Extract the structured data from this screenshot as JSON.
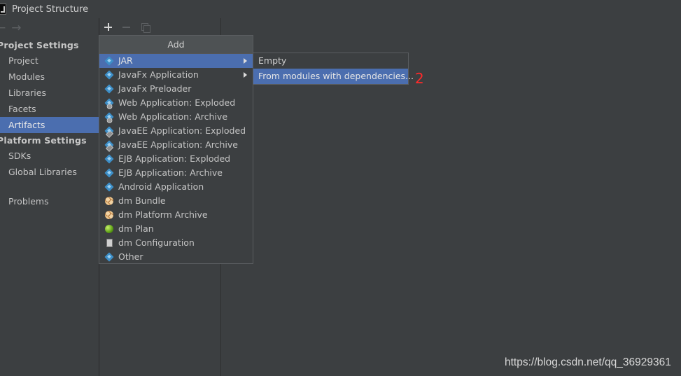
{
  "window": {
    "title": "Project Structure"
  },
  "toolbar": {
    "add_icon": "plus-icon",
    "remove_icon": "minus-icon",
    "copy_icon": "copy-icon"
  },
  "sidebar": {
    "project_settings_header": "Project Settings",
    "project_items": [
      "Project",
      "Modules",
      "Libraries",
      "Facets",
      "Artifacts"
    ],
    "selected": "Artifacts",
    "platform_settings_header": "Platform Settings",
    "platform_items": [
      "SDKs",
      "Global Libraries"
    ],
    "other_items": [
      "Problems"
    ]
  },
  "add_menu": {
    "header": "Add",
    "items": [
      {
        "label": "JAR",
        "icon": "jar-icon"
      },
      {
        "label": "JavaFx Application",
        "icon": "javafx-icon"
      },
      {
        "label": "JavaFx Preloader",
        "icon": "javafx-icon"
      },
      {
        "label": "Web Application: Exploded",
        "icon": "web-icon"
      },
      {
        "label": "Web Application: Archive",
        "icon": "web-icon"
      },
      {
        "label": "JavaEE Application: Exploded",
        "icon": "javaee-icon"
      },
      {
        "label": "JavaEE Application: Archive",
        "icon": "javaee-icon"
      },
      {
        "label": "EJB Application: Exploded",
        "icon": "ejb-icon"
      },
      {
        "label": "EJB Application: Archive",
        "icon": "ejb-icon"
      },
      {
        "label": "Android Application",
        "icon": "android-icon"
      },
      {
        "label": "dm Bundle",
        "icon": "dm-bundle-icon"
      },
      {
        "label": "dm Platform Archive",
        "icon": "dm-platform-icon"
      },
      {
        "label": "dm Plan",
        "icon": "dm-plan-icon"
      },
      {
        "label": "dm Configuration",
        "icon": "dm-configuration-icon"
      },
      {
        "label": "Other",
        "icon": "other-icon"
      }
    ],
    "selected": "JAR"
  },
  "jar_submenu": {
    "items": [
      "Empty",
      "From modules with dependencies..."
    ],
    "selected": "From modules with dependencies..."
  },
  "annotation": "2",
  "watermark": "https://blog.csdn.net/qq_36929361",
  "colors": {
    "selection": "#4b6eaf",
    "background": "#3c3f41",
    "annotation": "#ff2a2a"
  }
}
